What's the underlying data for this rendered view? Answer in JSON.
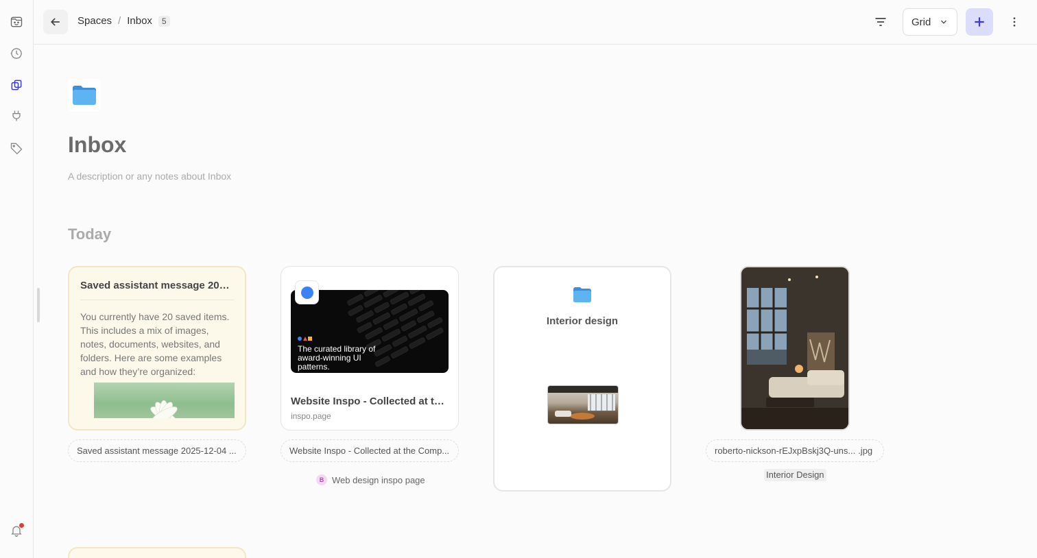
{
  "topbar": {
    "breadcrumb_root": "Spaces",
    "breadcrumb_separator": "/",
    "breadcrumb_current": "Inbox",
    "item_count": "5",
    "view_label": "Grid"
  },
  "space": {
    "title": "Inbox",
    "description_placeholder": "A description or any notes about Inbox"
  },
  "section": {
    "title": "Today"
  },
  "cards": {
    "note": {
      "title": "Saved assistant message 2025...",
      "body": "You currently have 20 saved items. This includes a mix of images, notes, documents, websites, and folders. Here are some examples and how they’re organized:",
      "caption": "Saved assistant message 2025-12-04 ..."
    },
    "website": {
      "tagline": "The curated library of award-winning UI patterns.",
      "title": "Website Inspo - Collected at the ...",
      "domain": "inspo.page",
      "caption": "Website Inspo - Collected at the Comp...",
      "tag_initial": "B",
      "tag_label": "Web design inspo page"
    },
    "folder": {
      "name": "Interior design"
    },
    "image": {
      "caption_stem": "roberto-nickson-rEJxpBskj3Q-uns...",
      "caption_ext": ".jpg",
      "tag_label": "Interior Design"
    }
  },
  "colors": {
    "accent": "#3b3bdb",
    "add_button_bg": "#dcdcfb",
    "note_bg": "#fdf9ea",
    "folder_blue": "#5db4f0",
    "notification_dot": "#e23b3b"
  },
  "icons": {
    "rail": [
      "logo-face-icon",
      "history-icon",
      "spaces-icon",
      "plug-icon",
      "tag-icon",
      "bell-icon"
    ],
    "topbar": [
      "arrow-left-icon",
      "filter-icon",
      "chevron-down-icon",
      "plus-icon",
      "more-vertical-icon"
    ]
  }
}
